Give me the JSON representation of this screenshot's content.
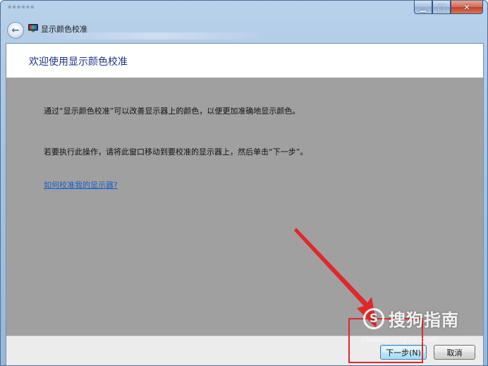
{
  "window": {
    "title": "显示颜色校准",
    "caption": {
      "minimize_glyph": "▁",
      "maximize_glyph": "□",
      "close_glyph": "✕"
    },
    "back_glyph": "←"
  },
  "main": {
    "heading": "欢迎使用显示颜色校准",
    "paragraph1": "通过“显示颜色校准”可以改善显示器上的颜色，以便更加准确地显示颜色。",
    "paragraph2": "若要执行此操作，请将此窗口移动到要校准的显示器上，然后单击“下一步”。",
    "help_link": "如何校准我的显示器?"
  },
  "footer": {
    "next_label": "下一步(N)",
    "cancel_label": "取消"
  },
  "watermark": {
    "logo_letter": "S",
    "brand": "搜狗指南",
    "url": "zhinan.sogou.com"
  },
  "colors": {
    "annotation_red": "#e0282a",
    "heading_blue": "#1e3287",
    "link_blue": "#1a5fc9",
    "content_gray": "#a0a0a0"
  }
}
